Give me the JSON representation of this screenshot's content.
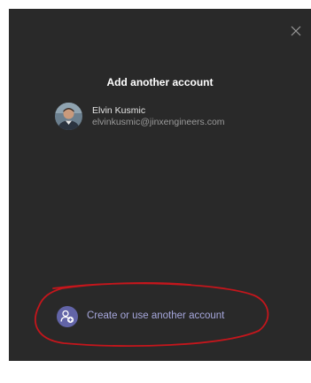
{
  "dialog": {
    "title": "Add another account",
    "close_icon": "close-icon"
  },
  "account": {
    "name": "Elvin Kusmic",
    "email": "elvinkusmic@jinxengineers.com",
    "avatar_icon": "avatar"
  },
  "create_account": {
    "label": "Create or use another account",
    "icon": "add-person-icon"
  },
  "colors": {
    "dialog_bg": "#292929",
    "accent": "#6264a7",
    "link_text": "#a6a7dc",
    "annotation": "#c4161c"
  }
}
